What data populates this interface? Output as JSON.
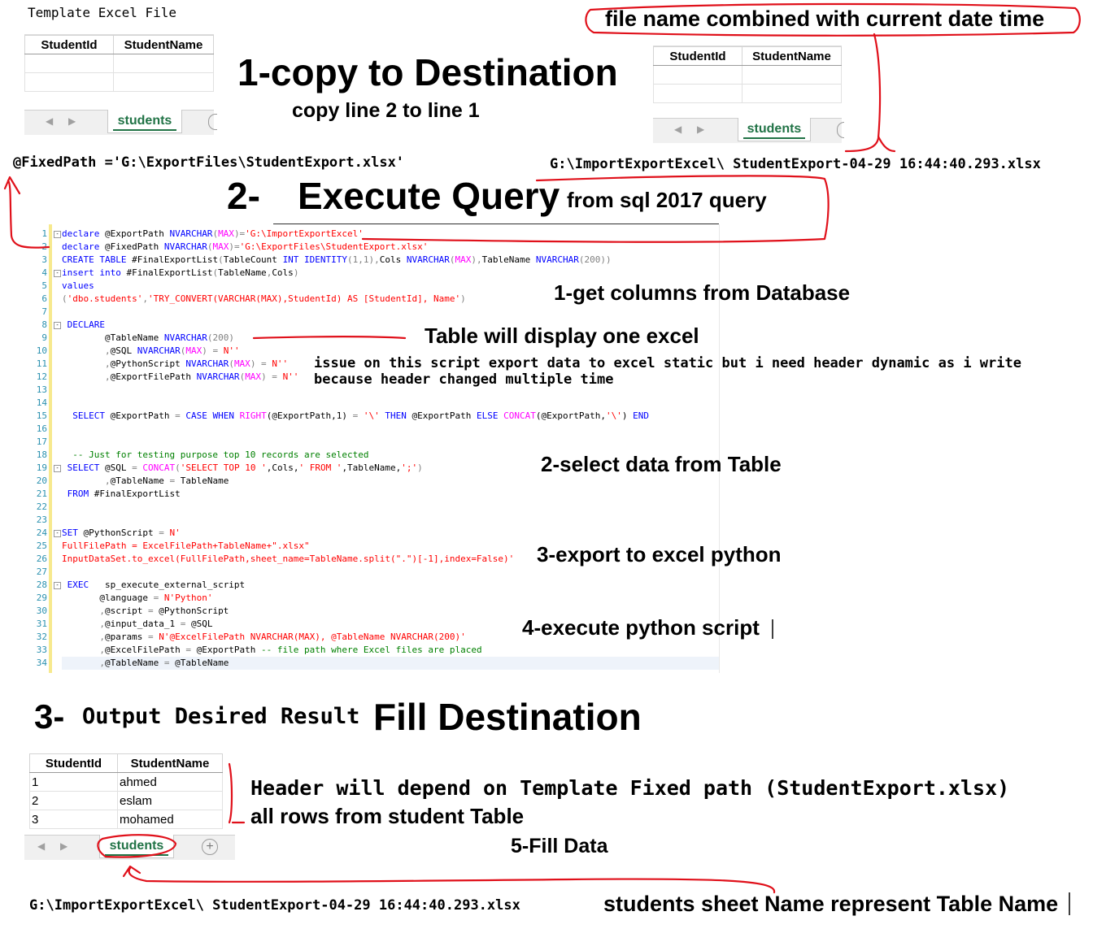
{
  "template_section": {
    "label": "Template Excel File",
    "headers": [
      "StudentId",
      "StudentName"
    ],
    "sheet_tab": "students"
  },
  "destination_section": {
    "callout": "file name combined with current date time",
    "headers": [
      "StudentId",
      "StudentName"
    ],
    "sheet_tab": "students"
  },
  "step1": {
    "title": "1-copy to Destination",
    "subtitle": "copy line 2 to line 1"
  },
  "paths": {
    "fixed_path": "@FixedPath ='G:\\ExportFiles\\StudentExport.xlsx'",
    "export_file": "G:\\ImportExportExcel\\ StudentExport-04-29 16:44:40.293.xlsx"
  },
  "step2": {
    "number": "2-",
    "title": "Execute Query",
    "subtitle": "from sql 2017 query"
  },
  "code": {
    "line_numbers": [
      "1",
      "2",
      "3",
      "4",
      "5",
      "6",
      "7",
      "8",
      "9",
      "10",
      "11",
      "12",
      "13",
      "14",
      "15",
      "16",
      "17",
      "18",
      "19",
      "20",
      "21",
      "22",
      "23",
      "24",
      "25",
      "26",
      "27",
      "28",
      "29",
      "30",
      "31",
      "32",
      "33",
      "34"
    ],
    "l1_kw": "declare",
    "l1_var": " @ExportPath ",
    "l1_type": "NVARCHAR",
    "l1_p1": "(",
    "l1_max": "MAX",
    "l1_p2": ")=",
    "l1_str": "'G:\\ImportExportExcel'",
    "l2_kw": "declare",
    "l2_var": " @FixedPath ",
    "l2_type": "NVARCHAR",
    "l2_p1": "(",
    "l2_max": "MAX",
    "l2_p2": ")=",
    "l2_str": "'G:\\ExportFiles\\StudentExport.xlsx'",
    "l3_kw1": "CREATE TABLE",
    "l3_t1": " #FinalExportList",
    "l3_p1": "(",
    "l3_t2": "TableCount ",
    "l3_kw2": "INT IDENTITY",
    "l3_p2": "(1,1),",
    "l3_t3": "Cols ",
    "l3_type1": "NVARCHAR",
    "l3_p3": "(",
    "l3_max": "MAX",
    "l3_p4": "),",
    "l3_t4": "TableName ",
    "l3_type2": "NVARCHAR",
    "l3_p5": "(200))",
    "l4_kw": "insert into",
    "l4_t": " #FinalExportList",
    "l4_p1": "(",
    "l4_t2": "TableName",
    "l4_p2": ",",
    "l4_t3": "Cols",
    "l4_p3": ")",
    "l5_kw": "values",
    "l6_p1": "(",
    "l6_s1": "'dbo.students'",
    "l6_p2": ",",
    "l6_s2": "'TRY_CONVERT(VARCHAR(MAX),StudentId) AS [StudentId], Name'",
    "l6_p3": ")",
    "l8_kw": "DECLARE",
    "l9_var": "@TableName ",
    "l9_type": "NVARCHAR",
    "l9_rest": "(200)",
    "l10_c": ",",
    "l10_var": "@SQL ",
    "l10_type": "NVARCHAR",
    "l10_p1": "(",
    "l10_max": "MAX",
    "l10_p2": ") = ",
    "l10_str": "N''",
    "l11_c": ",",
    "l11_var": "@PythonScript ",
    "l11_type": "NVARCHAR",
    "l11_p1": "(",
    "l11_max": "MAX",
    "l11_p2": ") = ",
    "l11_str": "N''",
    "l12_c": ",",
    "l12_var": "@ExportFilePath ",
    "l12_type": "NVARCHAR",
    "l12_p1": "(",
    "l12_max": "MAX",
    "l12_p2": ") = ",
    "l12_str": "N''",
    "l15_kw1": "SELECT",
    "l15_t1": " @ExportPath ",
    "l15_op1": "=",
    "l15_kw2": " CASE WHEN ",
    "l15_fn1": "RIGHT",
    "l15_t2": "(@ExportPath,1) ",
    "l15_op2": "=",
    "l15_s1": " '\\' ",
    "l15_kw3": "THEN",
    "l15_t3": " @ExportPath ",
    "l15_kw4": "ELSE ",
    "l15_fn2": "CONCAT",
    "l15_t4": "(@ExportPath,",
    "l15_s2": "'\\'",
    "l15_t5": ") ",
    "l15_kw5": "END",
    "l18_cm": "-- Just for testing purpose top 10 records are selected",
    "l19_kw": "SELECT",
    "l19_t1": " @SQL ",
    "l19_op": "=",
    "l19_fn": " CONCAT",
    "l19_p1": "(",
    "l19_s1": "'SELECT TOP 10 '",
    "l19_t2": ",Cols,",
    "l19_s2": "' FROM '",
    "l19_t3": ",TableName,",
    "l19_s3": "';'",
    "l19_p2": ")",
    "l20_c": ",",
    "l20_t": "@TableName ",
    "l20_op": "=",
    "l20_t2": " TableName",
    "l21_kw": "FROM",
    "l21_t": " #FinalExportList",
    "l24_kw": "SET",
    "l24_t": " @PythonScript ",
    "l24_op": "=",
    "l24_str": " N'",
    "l25_str": "FullFilePath = ExcelFilePath+TableName+\".xlsx\"",
    "l26_str": "InputDataSet.to_excel(FullFilePath,sheet_name=TableName.split(\".\")[-1],index=False)'",
    "l28_kw": "EXEC",
    "l28_t": "   sp_execute_external_script",
    "l29_t": "@language ",
    "l29_op": "=",
    "l29_str": " N'Python'",
    "l30_c": ",",
    "l30_t": "@script ",
    "l30_op": "=",
    "l30_t2": " @PythonScript",
    "l31_c": ",",
    "l31_t": "@input_data_1 ",
    "l31_op": "=",
    "l31_t2": " @SQL",
    "l32_c": ",",
    "l32_t": "@params ",
    "l32_op": "=",
    "l32_str": " N'@ExcelFilePath NVARCHAR(MAX), @TableName NVARCHAR(200)'",
    "l33_c": ",",
    "l33_t": "@ExcelFilePath ",
    "l33_op": "=",
    "l33_t2": " @ExportPath ",
    "l33_cm": "-- file path where Excel files are placed",
    "l34_c": ",",
    "l34_t": "@TableName ",
    "l34_op": "=",
    "l34_t2": " @TableName"
  },
  "annotations": {
    "get_columns": "1-get columns from Database",
    "one_excel": "Table will display one excel",
    "issue_line1": "issue on this script export data to excel static but i need header dynamic as i write",
    "issue_line2": "because header changed multiple time",
    "select_data": "2-select data from Table",
    "export_python": "3-export to excel python",
    "execute_python": "4-execute python script"
  },
  "step3": {
    "number": "3-",
    "label": "Output Desired Result",
    "title": "Fill Destination",
    "headers": [
      "StudentId",
      "StudentName"
    ],
    "rows": [
      {
        "id": "1",
        "name": "ahmed"
      },
      {
        "id": "2",
        "name": "eslam"
      },
      {
        "id": "3",
        "name": "mohamed"
      }
    ],
    "sheet_tab": "students",
    "header_note": "Header will depend on Template Fixed path (StudentExport.xlsx)",
    "rows_note": "all rows from student Table",
    "fill_data": "5-Fill Data",
    "output_path": "G:\\ImportExportExcel\\ StudentExport-04-29 16:44:40.293.xlsx",
    "sheet_note": "students sheet Name represent Table Name"
  }
}
